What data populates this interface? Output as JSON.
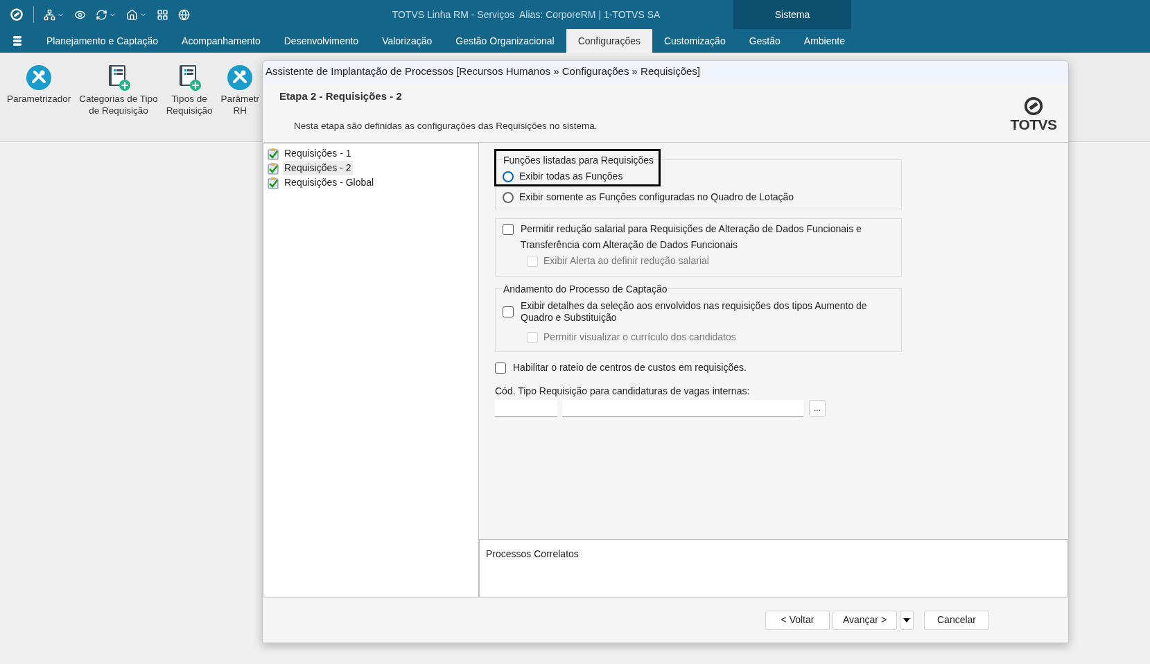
{
  "app": {
    "title": "TOTVS Linha RM - Serviços  Alias: CorporeRM | 1-TOTVS SA",
    "context_tab": "Sistema"
  },
  "menu": [
    {
      "label": "Planejamento e Captação",
      "selected": false
    },
    {
      "label": "Acompanhamento",
      "selected": false
    },
    {
      "label": "Desenvolvimento",
      "selected": false
    },
    {
      "label": "Valorização",
      "selected": false
    },
    {
      "label": "Gestão Organizacional",
      "selected": false
    },
    {
      "label": "Configurações",
      "selected": true
    },
    {
      "label": "Customização",
      "selected": false
    },
    {
      "label": "Gestão",
      "selected": false
    },
    {
      "label": "Ambiente",
      "selected": false
    }
  ],
  "ribbon": [
    {
      "kind": "tools",
      "lines": [
        "Parametrizador"
      ]
    },
    {
      "kind": "document",
      "lines": [
        "Categorias de Tipo",
        "de Requisição"
      ]
    },
    {
      "kind": "document",
      "lines": [
        "Tipos de",
        "Requisição"
      ]
    },
    {
      "kind": "tools",
      "lines": [
        "Parâmetr",
        "RH"
      ]
    }
  ],
  "dialog": {
    "title": "Assistente de Implantação de Processos [Recursos Humanos » Configurações » Requisições]",
    "step_title": "Etapa 2 - Requisições - 2",
    "step_description": "Nesta etapa são definidas as configurações das Requisições no sistema.",
    "logo": "TOTVS",
    "steps": [
      {
        "label": "Requisições - 1",
        "selected": false
      },
      {
        "label": "Requisições - 2",
        "selected": true
      },
      {
        "label": "Requisições - Global",
        "selected": false
      }
    ],
    "funcoes": {
      "legend": "Funções listadas para Requisições",
      "highlighted": true,
      "options": [
        {
          "label": "Exibir todas as Funções",
          "selected": true
        },
        {
          "label": "Exibir somente as Funções configuradas no Quadro de Lotação",
          "selected": false
        }
      ]
    },
    "reducao": {
      "label": "Permitir redução salarial para Requisições de Alteração de Dados Funcionais e Transferência com Alteração de Dados Funcionais",
      "checked": false,
      "sub": {
        "label": "Exibir Alerta ao definir redução salarial",
        "checked": false,
        "disabled": true
      }
    },
    "captacao": {
      "legend": "Andamento do Processo de Captação",
      "label": "Exibir detalhes da seleção aos envolvidos nas requisições dos tipos Aumento de Quadro e Substituição",
      "checked": false,
      "sub": {
        "label": "Permitir visualizar o currículo dos candidatos",
        "checked": false,
        "disabled": true
      }
    },
    "rateio": {
      "label": "Habilitar o rateio de centros de custos em requisições.",
      "checked": false
    },
    "cod_tipo": {
      "label": "Cód. Tipo Requisição para candidaturas de vagas internas:",
      "lookup": "..."
    },
    "correlatos": "Processos Correlatos",
    "buttons": {
      "back": "< Voltar",
      "next": "Avançar >",
      "cancel": "Cancelar"
    }
  }
}
